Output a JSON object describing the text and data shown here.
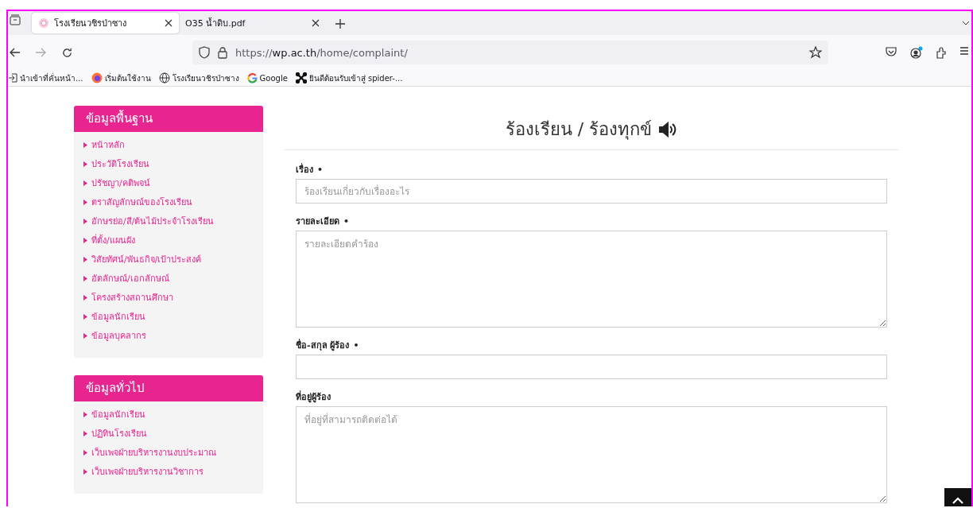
{
  "browser": {
    "tabs": [
      {
        "title": "โรงเรียนวชิรป่าซาง",
        "selected": true
      },
      {
        "title": "O35 น้ำดิบ.pdf",
        "selected": false
      }
    ],
    "url": {
      "scheme": "https://",
      "host": "wp.ac.th",
      "path": "/home/complaint/"
    },
    "bookmarks": [
      {
        "label": "นำเข้าที่คั่นหน้า..."
      },
      {
        "label": "เริ่มต้นใช้งาน"
      },
      {
        "label": "โรงเรียนวชิรป่าซาง"
      },
      {
        "label": "Google"
      },
      {
        "label": "ยินดีต้อนรับเข้าสู่ spider-..."
      }
    ]
  },
  "sidebar": {
    "sections": [
      {
        "title": "ข้อมูลพื้นฐาน",
        "items": [
          "หน้าหลัก",
          "ประวัติโรงเรียน",
          "ปรัชญา/คติพจน์",
          "ตราสัญลักษณ์ของโรงเรียน",
          "อักษรย่อ/สี/ต้นไม้ประจำโรงเรียน",
          "ที่ตั้ง/แผนผัง",
          "วิสัยทัศน์/พันธกิจ/เป้าประสงค์",
          "อัตลักษณ์/เอกลักษณ์",
          "โครงสร้างสถานศึกษา",
          "ข้อมูลนักเรียน",
          "ข้อมูลบุคลากร"
        ]
      },
      {
        "title": "ข้อมูลทั่วไป",
        "items": [
          "ข้อมูลนักเรียน",
          "ปฏิทินโรงเรียน",
          "เว็บเพจฝ่ายบริหารงานงบประมาณ",
          "เว็บเพจฝ่ายบริหารงานวิชาการ"
        ]
      }
    ]
  },
  "form": {
    "title": "ร้องเรียน / ร้องทุกข์",
    "fields": [
      {
        "label": "เรื่อง",
        "mark": "•",
        "kind": "input",
        "placeholder": "ร้องเรียนเกี่ยวกับเรื่องอะไร"
      },
      {
        "label": "รายละเอียด",
        "mark": "•",
        "kind": "textarea",
        "placeholder": "รายละเอียดคำร้อง"
      },
      {
        "label": "ชื่อ-สกุล ผู้ร้อง",
        "mark": "•",
        "kind": "input"
      },
      {
        "label": "ที่อยู่ผู้ร้อง",
        "kind": "textarea",
        "placeholder": "ที่อยู่ที่สามารถติดต่อได้"
      }
    ]
  }
}
